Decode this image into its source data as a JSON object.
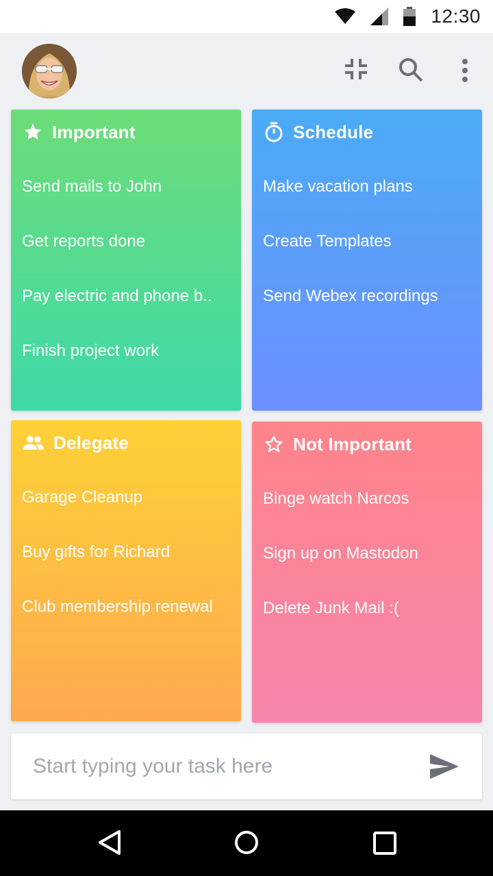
{
  "status_bar": {
    "time": "12:30",
    "icons": [
      "wifi-icon",
      "cell-signal-icon",
      "battery-icon"
    ]
  },
  "top_bar": {
    "avatar": "user-avatar",
    "actions": [
      "collapse-icon",
      "search-icon",
      "more-vert-icon"
    ]
  },
  "quadrants": {
    "important": {
      "title": "Important",
      "icon": "star-filled-icon",
      "color_top": "#6ddc78",
      "color_bottom": "#3ed9a8",
      "tasks": [
        "Send mails to John",
        "Get reports done",
        "Pay electric and phone b..",
        "Finish project work"
      ]
    },
    "schedule": {
      "title": "Schedule",
      "icon": "stopwatch-icon",
      "color_top": "#4aabf6",
      "color_bottom": "#6d8ffd",
      "tasks": [
        "Make vacation plans",
        "Create Templates",
        "Send Webex recordings"
      ]
    },
    "delegate": {
      "title": "Delegate",
      "icon": "people-icon",
      "color_top": "#fed136",
      "color_bottom": "#fda950",
      "tasks": [
        "Garage Cleanup",
        "Buy gifts for Richard",
        "Club membership renewal"
      ]
    },
    "not_important": {
      "title": "Not Important",
      "icon": "star-outline-icon",
      "color_top": "#fe848a",
      "color_bottom": "#f785ab",
      "tasks": [
        "Binge watch Narcos",
        "Sign up on Mastodon",
        "Delete Junk Mail :("
      ]
    }
  },
  "task_input": {
    "placeholder": "Start typing your task here",
    "value": "",
    "send_icon": "send-icon"
  },
  "nav_bar": {
    "buttons": [
      "back-icon",
      "home-icon",
      "recents-icon"
    ]
  }
}
